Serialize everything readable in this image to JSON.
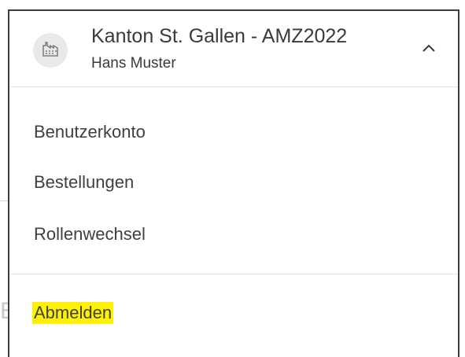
{
  "account": {
    "organization": "Kanton St. Gallen - AMZ2022",
    "user": "Hans Muster",
    "avatar_icon": "factory-icon",
    "toggle_icon": "chevron-up-icon"
  },
  "menu": {
    "items": [
      {
        "label": "Benutzerkonto"
      },
      {
        "label": "Bestellungen"
      },
      {
        "label": "Rollenwechsel"
      }
    ],
    "logout_label": "Abmelden"
  },
  "colors": {
    "highlight": "#fff200",
    "border": "#3e3e3e",
    "text": "#404040",
    "avatar_bg": "#e9e9e9"
  }
}
